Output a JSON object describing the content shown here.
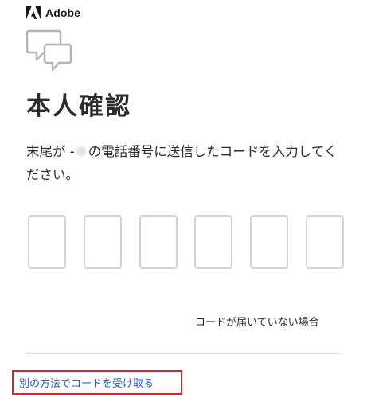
{
  "brand": {
    "name": "Adobe",
    "logo_icon": "adobe-logo-icon",
    "logo_color": "#1a1a1a"
  },
  "header_icon": "speech-bubbles-icon",
  "title": "本人確認",
  "message": {
    "before": "末尾が -",
    "after": "の電話番号に送信したコードを入力してください。"
  },
  "code_inputs": [
    {
      "value": ""
    },
    {
      "value": ""
    },
    {
      "value": ""
    },
    {
      "value": ""
    },
    {
      "value": ""
    },
    {
      "value": ""
    }
  ],
  "links": {
    "no_code": "コードが届いていない場合",
    "other_method": "別の方法でコードを受け取る"
  },
  "colors": {
    "link_blue": "#1f63c8",
    "highlight_red": "#e0202a",
    "input_border": "#d3d3d3",
    "icon_gray": "#b4b4b4"
  }
}
